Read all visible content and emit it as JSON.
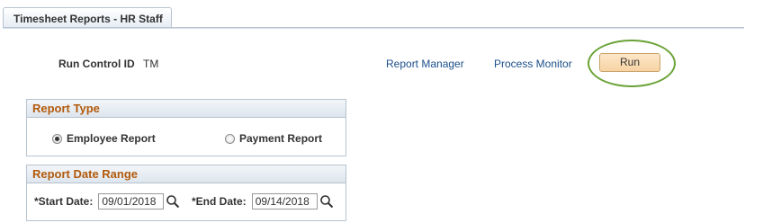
{
  "tab": {
    "label": "Timesheet Reports - HR Staff"
  },
  "run_control": {
    "label": "Run Control ID",
    "value": "TM"
  },
  "links": {
    "report_manager": "Report Manager",
    "process_monitor": "Process Monitor"
  },
  "run_button": {
    "label": "Run"
  },
  "report_type": {
    "title": "Report Type",
    "options": [
      {
        "label": "Employee Report",
        "selected": true
      },
      {
        "label": "Payment Report",
        "selected": false
      }
    ]
  },
  "date_range": {
    "title": "Report Date Range",
    "start": {
      "label": "*Start Date:",
      "value": "09/01/2018"
    },
    "end": {
      "label": "*End Date:",
      "value": "09/14/2018"
    }
  },
  "colors": {
    "group_title": "#b25a0b",
    "link": "#1c4f8a",
    "highlight": "#6aa337",
    "button_bg": "#f7d4a4"
  },
  "icons": {
    "lookup": "magnifier-icon"
  }
}
